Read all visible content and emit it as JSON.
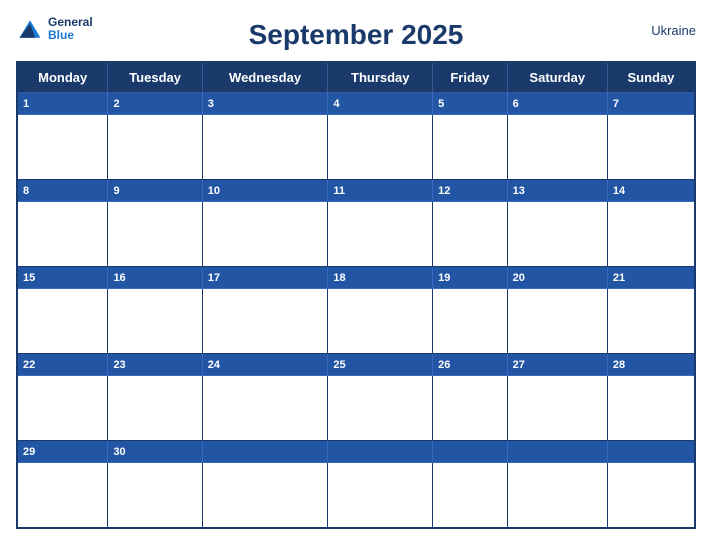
{
  "header": {
    "title": "September 2025",
    "country": "Ukraine",
    "logo_general": "General",
    "logo_blue": "Blue"
  },
  "weekdays": [
    "Monday",
    "Tuesday",
    "Wednesday",
    "Thursday",
    "Friday",
    "Saturday",
    "Sunday"
  ],
  "weeks": [
    {
      "numbers": [
        "1",
        "2",
        "3",
        "4",
        "5",
        "6",
        "7"
      ]
    },
    {
      "numbers": [
        "8",
        "9",
        "10",
        "11",
        "12",
        "13",
        "14"
      ]
    },
    {
      "numbers": [
        "15",
        "16",
        "17",
        "18",
        "19",
        "20",
        "21"
      ]
    },
    {
      "numbers": [
        "22",
        "23",
        "24",
        "25",
        "26",
        "27",
        "28"
      ]
    },
    {
      "numbers": [
        "29",
        "30",
        "",
        "",
        "",
        "",
        ""
      ]
    }
  ]
}
